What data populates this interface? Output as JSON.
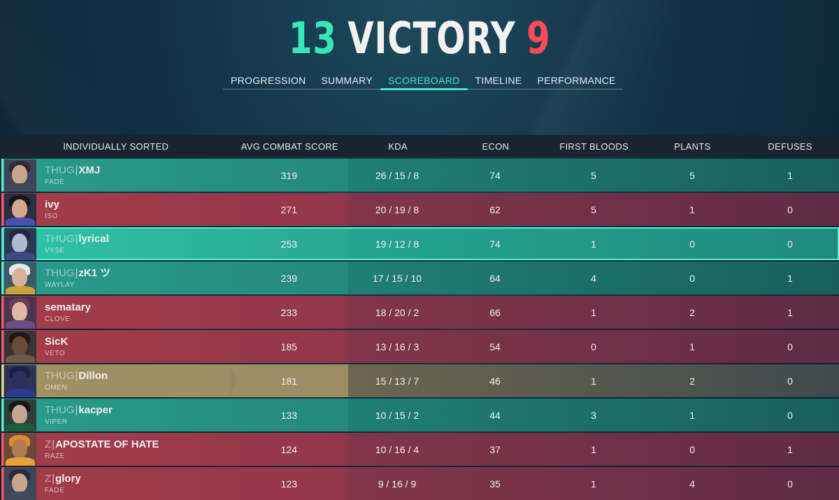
{
  "header": {
    "ally_score": "13",
    "result": "VICTORY",
    "enemy_score": "9"
  },
  "tabs": [
    {
      "label": "PROGRESSION",
      "active": false
    },
    {
      "label": "SUMMARY",
      "active": false
    },
    {
      "label": "SCOREBOARD",
      "active": true
    },
    {
      "label": "TIMELINE",
      "active": false
    },
    {
      "label": "PERFORMANCE",
      "active": false
    }
  ],
  "table": {
    "columns": [
      "INDIVIDUALLY SORTED",
      "AVG COMBAT SCORE",
      "KDA",
      "ECON",
      "FIRST BLOODS",
      "PLANTS",
      "DEFUSES"
    ],
    "rows": [
      {
        "team": "ally",
        "tag": "THUG",
        "name": "XMJ",
        "agent": "FADE",
        "acs": "319",
        "kda": "26 / 15 / 8",
        "econ": "74",
        "first_bloods": "5",
        "plants": "5",
        "defuses": "1"
      },
      {
        "team": "enemy",
        "tag": "",
        "name": "ivy",
        "agent": "ISO",
        "acs": "271",
        "kda": "20 / 19 / 8",
        "econ": "62",
        "first_bloods": "5",
        "plants": "1",
        "defuses": "0"
      },
      {
        "team": "self",
        "tag": "THUG",
        "name": "lyrical",
        "agent": "VYSE",
        "acs": "253",
        "kda": "19 / 12 / 8",
        "econ": "74",
        "first_bloods": "1",
        "plants": "0",
        "defuses": "0"
      },
      {
        "team": "ally",
        "tag": "THUG",
        "name": "zK1 ツ",
        "agent": "WAYLAY",
        "acs": "239",
        "kda": "17 / 15 / 10",
        "econ": "64",
        "first_bloods": "4",
        "plants": "0",
        "defuses": "1"
      },
      {
        "team": "enemy",
        "tag": "",
        "name": "sematary",
        "agent": "CLOVE",
        "acs": "233",
        "kda": "18 / 20 / 2",
        "econ": "66",
        "first_bloods": "1",
        "plants": "2",
        "defuses": "1"
      },
      {
        "team": "enemy",
        "tag": "",
        "name": "SicK",
        "agent": "VETO",
        "acs": "185",
        "kda": "13 / 16 / 3",
        "econ": "54",
        "first_bloods": "0",
        "plants": "1",
        "defuses": "0"
      },
      {
        "team": "party",
        "tag": "THUG",
        "name": "Dillon",
        "agent": "OMEN",
        "acs": "181",
        "kda": "15 / 13 / 7",
        "econ": "46",
        "first_bloods": "1",
        "plants": "2",
        "defuses": "0"
      },
      {
        "team": "ally",
        "tag": "THUG",
        "name": "kacper",
        "agent": "VIPER",
        "acs": "133",
        "kda": "10 / 15 / 2",
        "econ": "44",
        "first_bloods": "3",
        "plants": "1",
        "defuses": "0"
      },
      {
        "team": "enemy",
        "tag": "Z",
        "name": "APOSTATE OF HATE",
        "agent": "RAZE",
        "acs": "124",
        "kda": "10 / 16 / 4",
        "econ": "37",
        "first_bloods": "1",
        "plants": "0",
        "defuses": "1"
      },
      {
        "team": "enemy",
        "tag": "Z",
        "name": "glory",
        "agent": "FADE",
        "acs": "123",
        "kda": "9 / 16 / 9",
        "econ": "35",
        "first_bloods": "1",
        "plants": "4",
        "defuses": "0"
      }
    ]
  },
  "colors": {
    "ally_accent": "#39e6b7",
    "enemy_accent": "#ff4a5a",
    "active_tab": "#44e2c0"
  }
}
